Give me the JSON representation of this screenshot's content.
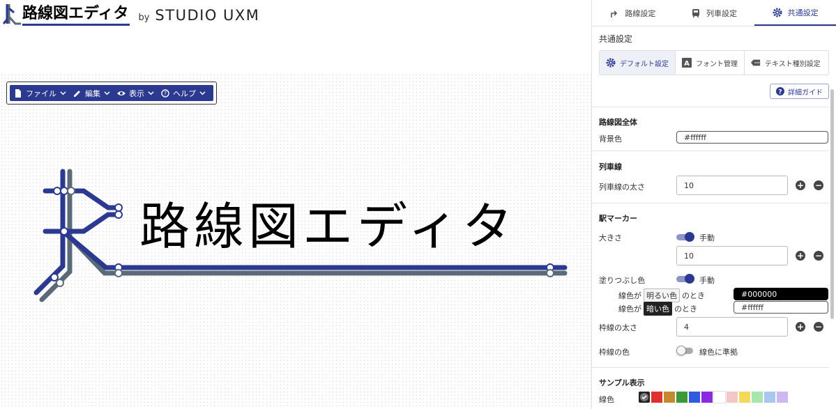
{
  "header": {
    "app_title": "路線図エディタ",
    "by": "by",
    "studio": "STUDIO UXM"
  },
  "toolbar": {
    "file": "ファイル",
    "edit": "編集",
    "view": "表示",
    "help": "ヘルプ"
  },
  "canvas": {
    "logo_text": "路線図エディタ"
  },
  "panel": {
    "tabs": [
      {
        "label": "路線設定"
      },
      {
        "label": "列車設定"
      },
      {
        "label": "共通設定"
      }
    ],
    "section_title": "共通設定",
    "subtabs": [
      {
        "label": "デフォルト設定"
      },
      {
        "label": "フォント管理"
      },
      {
        "label": "テキスト種別設定"
      }
    ],
    "guide_button": "詳細ガイド",
    "whole_map": {
      "heading": "路線図全体",
      "bg_label": "背景色",
      "bg_value": "#ffffff"
    },
    "train_line": {
      "heading": "列車線",
      "width_label": "列車線の太さ",
      "width_value": "10"
    },
    "station_marker": {
      "heading": "駅マーカー",
      "size_label": "大きさ",
      "size_mode": "手動",
      "size_value": "10",
      "fill_label": "塗りつぶし色",
      "fill_mode": "手動",
      "fill_line_prefix": "線色が",
      "fill_light_chip": "明るい色",
      "fill_dark_chip": "暗い色",
      "fill_suffix": "のとき",
      "fill_light_value": "#000000",
      "fill_dark_value": "#ffffff",
      "border_width_label": "枠線の太さ",
      "border_width_value": "4",
      "border_color_label": "枠線の色",
      "border_color_mode": "線色に準拠"
    },
    "sample": {
      "heading": "サンプル表示",
      "line_color_label": "線色",
      "swatches": [
        "#222222",
        "#e03030",
        "#c58a2e",
        "#3a9a3a",
        "#2f5be0",
        "#8a2be2",
        "#ffffff",
        "#f4c7c7",
        "#f3d85a",
        "#a8e6b0",
        "#a8c8f0",
        "#cdb8f0"
      ]
    }
  },
  "colors": {
    "brand": "#2b3990",
    "line_gray": "#5b6a78"
  }
}
